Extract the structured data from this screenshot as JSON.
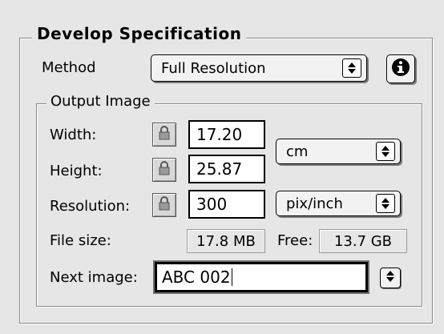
{
  "section_title": "Develop Specification",
  "method": {
    "label": "Method",
    "value": "Full Resolution"
  },
  "output_image": {
    "title": "Output Image",
    "width": {
      "label": "Width:",
      "value": "17.20"
    },
    "height": {
      "label": "Height:",
      "value": "25.87"
    },
    "resolution": {
      "label": "Resolution:",
      "value": "300"
    },
    "size_units": "cm",
    "resolution_units": "pix/inch",
    "file_size": {
      "label": "File size:",
      "value": "17.8 MB"
    },
    "free": {
      "label": "Free:",
      "value": "13.7 GB"
    },
    "next_image": {
      "label": "Next image:",
      "value": "ABC 002"
    }
  },
  "icons": {
    "info": "info-icon",
    "lock": "lock-icon",
    "popup_arrows": "up-down-arrows-icon"
  }
}
